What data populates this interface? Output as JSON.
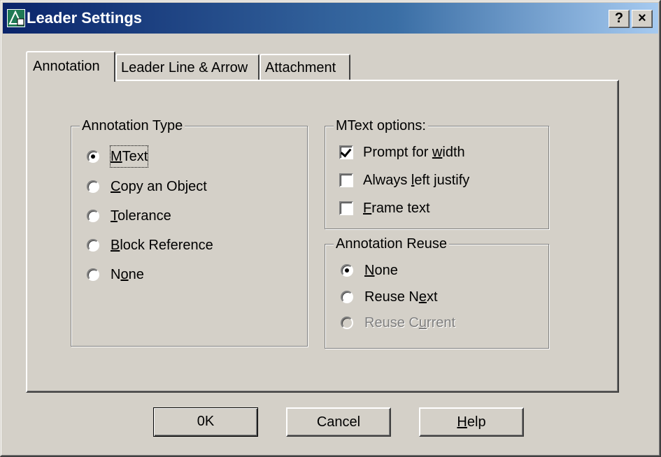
{
  "window": {
    "title": "Leader Settings",
    "help_btn": "?",
    "close_btn": "×"
  },
  "tabs": [
    {
      "label": "Annotation",
      "active": true
    },
    {
      "label": "Leader Line & Arrow",
      "active": false
    },
    {
      "label": "Attachment",
      "active": false
    }
  ],
  "annotation_type": {
    "legend": "Annotation Type",
    "options": [
      {
        "pre": "",
        "u": "M",
        "post": "Text",
        "selected": true
      },
      {
        "pre": "",
        "u": "C",
        "post": "opy an Object",
        "selected": false
      },
      {
        "pre": "",
        "u": "T",
        "post": "olerance",
        "selected": false
      },
      {
        "pre": "",
        "u": "B",
        "post": "lock Reference",
        "selected": false
      },
      {
        "pre": "N",
        "u": "o",
        "post": "ne",
        "selected": false
      }
    ]
  },
  "mtext_options": {
    "legend": "MText options:",
    "options": [
      {
        "pre": "Prompt for ",
        "u": "w",
        "post": "idth",
        "checked": true
      },
      {
        "pre": "Always ",
        "u": "l",
        "post": "eft justify",
        "checked": false
      },
      {
        "pre": "",
        "u": "F",
        "post": "rame text",
        "checked": false
      }
    ]
  },
  "annotation_reuse": {
    "legend": "Annotation Reuse",
    "options": [
      {
        "pre": "",
        "u": "N",
        "post": "one",
        "selected": true,
        "disabled": false
      },
      {
        "pre": "Reuse N",
        "u": "e",
        "post": "xt",
        "selected": false,
        "disabled": false
      },
      {
        "pre": "Reuse C",
        "u": "u",
        "post": "rrent",
        "selected": false,
        "disabled": true
      }
    ]
  },
  "buttons": {
    "ok": "0K",
    "cancel": "Cancel",
    "help_pre": "",
    "help_u": "H",
    "help_post": "elp"
  }
}
